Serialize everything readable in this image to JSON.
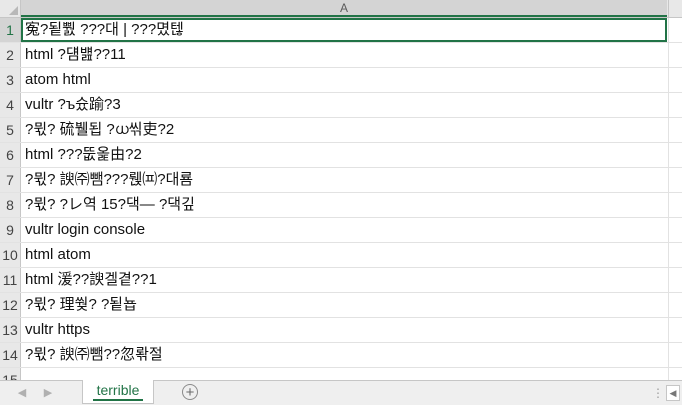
{
  "column_header": "A",
  "active_row": 0,
  "rows": [
    {
      "num": "1",
      "text": "寃?됱뿴 ???대 | ???몄텒"
    },
    {
      "num": "2",
      "text": "html ?덈뱶??11"
    },
    {
      "num": "3",
      "text": "atom html"
    },
    {
      "num": "4",
      "text": "vultr ?ъ슜踰?3"
    },
    {
      "num": "5",
      "text": "?뮋? 硫뷀됩 ?ധ씪吏?2"
    },
    {
      "num": "6",
      "text": "html ???뚮옱由?2"
    },
    {
      "num": "7",
      "text": "?뮋? 諛㈜뺌???뤥㈌?대룜"
    },
    {
      "num": "8",
      "text": "?뮋? ?レ역 15?댁— ?댁깊"
    },
    {
      "num": "9",
      "text": "vultr login console"
    },
    {
      "num": "10",
      "text": "html atom"
    },
    {
      "num": "11",
      "text": "html 湲??諛겔곁??1"
    },
    {
      "num": "12",
      "text": "?뮋? 理쒖? ?됱뇹"
    },
    {
      "num": "13",
      "text": "vultr https"
    },
    {
      "num": "14",
      "text": "?뮋? 諛㈜뺌??忽롺절"
    },
    {
      "num": "15",
      "text": ""
    }
  ],
  "tabbar": {
    "prev_arrow": "◀",
    "next_arrow": "▶",
    "sheet_tab": "terrible",
    "add_sheet": "+",
    "dots": "⋮",
    "scroll_left": "◀"
  }
}
